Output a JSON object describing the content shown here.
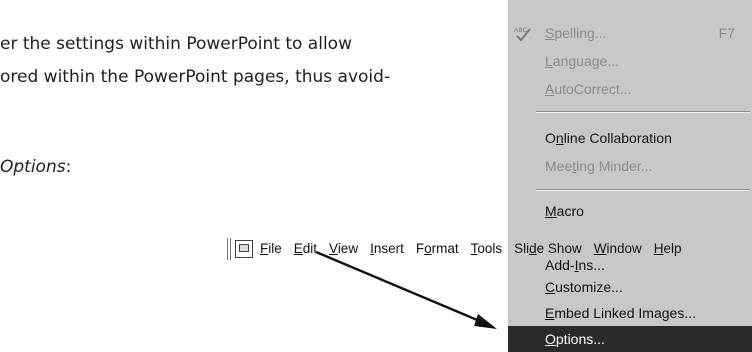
{
  "document": {
    "line1": "er the settings within PowerPoint to allow",
    "line2": "ored within the PowerPoint pages, thus avoid-",
    "line3_italic": "Options",
    "line3_rest": ":"
  },
  "menubar": {
    "items": [
      {
        "pre": "",
        "ul": "F",
        "post": "ile"
      },
      {
        "pre": "",
        "ul": "E",
        "post": "dit"
      },
      {
        "pre": "",
        "ul": "V",
        "post": "iew"
      },
      {
        "pre": "",
        "ul": "I",
        "post": "nsert"
      },
      {
        "pre": "F",
        "ul": "o",
        "post": "rmat"
      },
      {
        "pre": "",
        "ul": "T",
        "post": "ools"
      },
      {
        "pre": "Sli",
        "ul": "d",
        "post": "e Show"
      },
      {
        "pre": "",
        "ul": "W",
        "post": "indow"
      },
      {
        "pre": "",
        "ul": "H",
        "post": "elp"
      }
    ]
  },
  "dropdown": {
    "spelling": {
      "pre": "",
      "ul": "S",
      "post": "pelling...",
      "shortcut": "F7",
      "icon": "spelling-abc-check-icon"
    },
    "language": {
      "pre": "",
      "ul": "L",
      "post": "anguage..."
    },
    "autocorrect": {
      "pre": "",
      "ul": "A",
      "post": "utoCorrect..."
    },
    "online_collab": {
      "pre": "O",
      "ul": "n",
      "post": "line Collaboration"
    },
    "meeting_minder": {
      "pre": "Mee",
      "ul": "t",
      "post": "ing Minder..."
    },
    "macro": {
      "pre": "",
      "ul": "M",
      "post": "acro"
    },
    "addins": {
      "pre": "Add-",
      "ul": "I",
      "post": "ns..."
    },
    "customize": {
      "pre": "",
      "ul": "C",
      "post": "ustomize..."
    },
    "embed": {
      "pre": "",
      "ul": "E",
      "post": "mbed Linked Images..."
    },
    "options": {
      "pre": "",
      "ul": "O",
      "post": "ptions..."
    }
  },
  "colors": {
    "menu_background": "#c8c8c8",
    "highlight": "#2a2a2a",
    "disabled_text": "#8a8a8a"
  }
}
